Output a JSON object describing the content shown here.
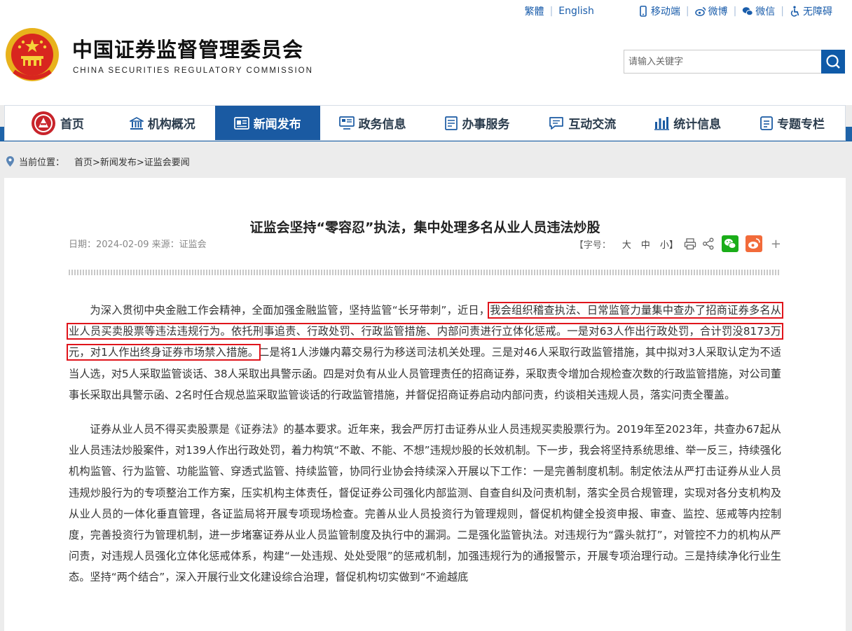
{
  "header": {
    "title_cn": "中国证券监督管理委员会",
    "title_en": "CHINA SECURITIES REGULATORY COMMISSION",
    "toplinks": {
      "traditional": "繁體",
      "english": "English",
      "mobile": "移动端",
      "weibo": "微博",
      "wechat": "微信",
      "accessibility": "无障碍"
    },
    "search": {
      "placeholder": "请输入关键字"
    }
  },
  "nav": {
    "items": [
      {
        "label": "首页",
        "icon": "csrc-logo-icon"
      },
      {
        "label": "机构概况",
        "icon": "building-icon"
      },
      {
        "label": "新闻发布",
        "icon": "news-icon",
        "active": true
      },
      {
        "label": "政务信息",
        "icon": "monitor-icon"
      },
      {
        "label": "办事服务",
        "icon": "list-icon"
      },
      {
        "label": "互动交流",
        "icon": "chat-icon"
      },
      {
        "label": "统计信息",
        "icon": "bar-chart-icon"
      },
      {
        "label": "专题专栏",
        "icon": "document-icon"
      }
    ]
  },
  "breadcrumb": {
    "label": "当前位置：",
    "path": "首页>新闻发布>证监会要闻"
  },
  "article": {
    "title": "证监会坚持“零容忍”执法，集中处理多名从业人员违法炒股",
    "meta": "日期：2024-02-09 来源：证监会",
    "font_size_label": "【字号：",
    "size_large": "大",
    "size_medium": "中",
    "size_small": "小】",
    "p1_before": "为深入贯彻中央金融工作会精神，全面加强金融监管，坚持监管“长牙带刺”，近日，",
    "p1_highlight": "我会组织稽查执法、日常监管力量集中查办了招商证券多名从业人员买卖股票等违法违规行为。依托刑事追责、行政处罚、行政监管措施、内部问责进行立体化惩戒。一是对63人作出行政处罚，合计罚没8173万元，对1人作出终身证券市场禁入措施。",
    "p1_after": "二是将1人涉嫌内幕交易行为移送司法机关处理。三是对46人采取行政监管措施，其中拟对3人采取认定为不适当人选，对5人采取监管谈话、38人采取出具警示函。四是对负有从业人员管理责任的招商证券，采取责令增加合规检查次数的行政监管措施，对公司董事长采取出具警示函、2名时任合规总监采取监管谈话的行政监管措施，并督促招商证券启动内部问责，约谈相关违规人员，落实问责全覆盖。",
    "p2": "证券从业人员不得买卖股票是《证券法》的基本要求。近年来，我会严厉打击证券从业人员违规买卖股票行为。2019年至2023年，共查办67起从业人员违法炒股案件，对139人作出行政处罚，着力构筑“不敢、不能、不想”违规炒股的长效机制。下一步，我会将坚持系统思维、举一反三，持续强化机构监管、行为监管、功能监管、穿透式监管、持续监管，协同行业协会持续深入开展以下工作：一是完善制度机制。制定依法从严打击证券从业人员违规炒股行为的专项整治工作方案，压实机构主体责任，督促证券公司强化内部监测、自查自纠及问责机制，落实全员合规管理，实现对各分支机构及从业人员的一体化垂直管理，各证监局将开展专项现场检查。完善从业人员投资行为管理规则，督促机构健全投资申报、审查、监控、惩戒等内控制度，完善投资行为管理机制，进一步堵塞证券从业人员监管制度及执行中的漏洞。二是强化监管执法。对违规行为“露头就打”，对管控不力的机构从严问责，对违规人员强化立体化惩戒体系，构建“一处违规、处处受限”的惩戒机制，加强违规行为的通报警示，开展专项治理行动。三是持续净化行业生态。坚持“两个结合”，深入开展行业文化建设综合治理，督促机构切实做到“不逾越底"
  },
  "colors": {
    "brand_blue": "#1a5aa2",
    "highlight_red": "#e0141b",
    "wechat_green": "#1aad19",
    "weibo_orange": "#f26b3a"
  }
}
